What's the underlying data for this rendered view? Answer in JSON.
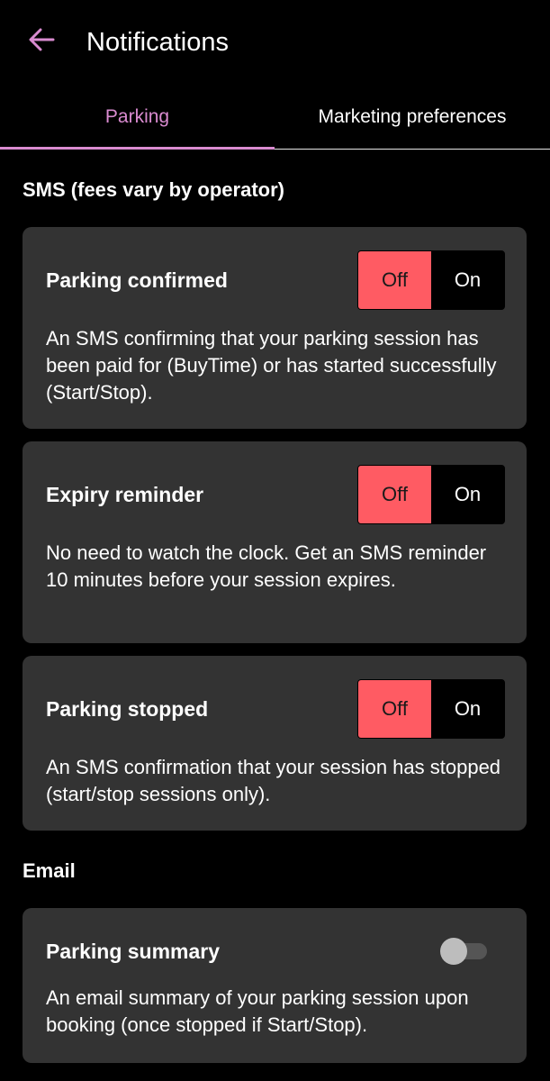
{
  "header": {
    "title": "Notifications",
    "back_icon": "arrow-left-icon",
    "accent_color": "#d98bd0"
  },
  "tabs": [
    {
      "label": "Parking",
      "active": true
    },
    {
      "label": "Marketing preferences",
      "active": false
    }
  ],
  "sms": {
    "heading": "SMS (fees vary by operator)",
    "items": [
      {
        "title": "Parking confirmed",
        "description": "An SMS confirming that your parking session has been paid for (BuyTime) or has started successfully (Start/Stop).",
        "off_label": "Off",
        "on_label": "On",
        "selected": "Off"
      },
      {
        "title": "Expiry reminder",
        "description": "No need to watch the clock. Get an SMS reminder 10 minutes before your session expires.",
        "off_label": "Off",
        "on_label": "On",
        "selected": "Off"
      },
      {
        "title": "Parking stopped",
        "description": "An SMS confirmation that your session has stopped (start/stop sessions only).",
        "off_label": "Off",
        "on_label": "On",
        "selected": "Off"
      }
    ],
    "off_selected_color": "#ff5b63"
  },
  "email": {
    "heading": "Email",
    "items": [
      {
        "title": "Parking summary",
        "description": "An email summary of your parking session upon booking (once stopped if Start/Stop).",
        "enabled": false
      }
    ]
  }
}
